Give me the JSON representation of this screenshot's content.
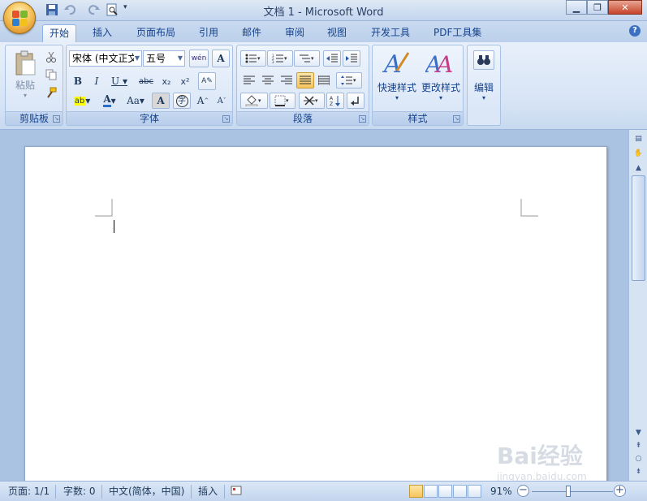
{
  "window": {
    "title": "文档 1 - Microsoft Word"
  },
  "tabs": [
    "开始",
    "插入",
    "页面布局",
    "引用",
    "邮件",
    "审阅",
    "视图",
    "开发工具",
    "PDF工具集"
  ],
  "ribbon": {
    "clipboard": {
      "label": "剪贴板",
      "paste": "粘贴"
    },
    "font": {
      "label": "字体",
      "font_name": "宋体 (中文正文",
      "font_size": "五号"
    },
    "paragraph": {
      "label": "段落"
    },
    "styles": {
      "label": "样式",
      "quick_styles": "快速样式",
      "change_styles": "更改样式"
    },
    "editing": {
      "label": "编辑"
    }
  },
  "status": {
    "page": "页面: 1/1",
    "words": "字数: 0",
    "language": "中文(简体，中国)",
    "mode": "插入",
    "zoom": "91%"
  },
  "watermark": {
    "main": "Bai经验",
    "sub": "jingyan.baidu.com"
  }
}
